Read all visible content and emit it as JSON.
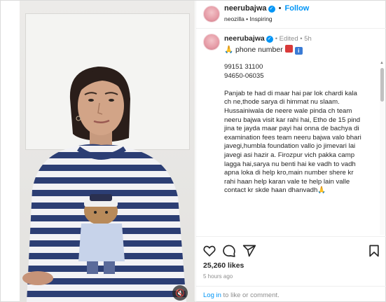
{
  "header": {
    "username": "neerubajwa",
    "separator": "•",
    "follow_label": "Follow",
    "subtitle": "neozilla • Inspiring"
  },
  "caption": {
    "username": "neerubajwa",
    "meta": "• Edited • 5h",
    "phone_label": "🙏 phone number",
    "phone_1": "99151 31100",
    "phone_2": "94650-06035",
    "para_1": "Panjab te had di maar hai par lok chardi kala ch ne,thode sarya di himmat nu slaam.",
    "para_2": "Hussainiwala de neere wale pinda ch team neeru bajwa visit kar rahi hai, Etho de 15 pind jina te jayda maar payi hai onna de bachya di examination fees team neeru bajwa valo bhari javegi,humbla foundation vallo jo jimevari lai javegi asi hazir a. Firozpur vich pakka camp lagga hai,sarya nu benti hai ke vadh to vadh apna loka di help kro,main number shere kr rahi haan help karan vale te help lain valle contact kr skde haan dhanvadh🙏"
  },
  "stats": {
    "likes": "25,260 likes",
    "time": "5 hours ago"
  },
  "login": {
    "link": "Log in",
    "rest": " to like or comment."
  },
  "icons": {
    "like": "heart-icon",
    "comment": "comment-icon",
    "share": "share-icon",
    "save": "bookmark-icon",
    "mute": "speaker-muted-icon",
    "verified": "verified-badge-icon"
  },
  "colors": {
    "accent": "#0095f6",
    "text": "#262626",
    "muted": "#8e8e8e"
  }
}
